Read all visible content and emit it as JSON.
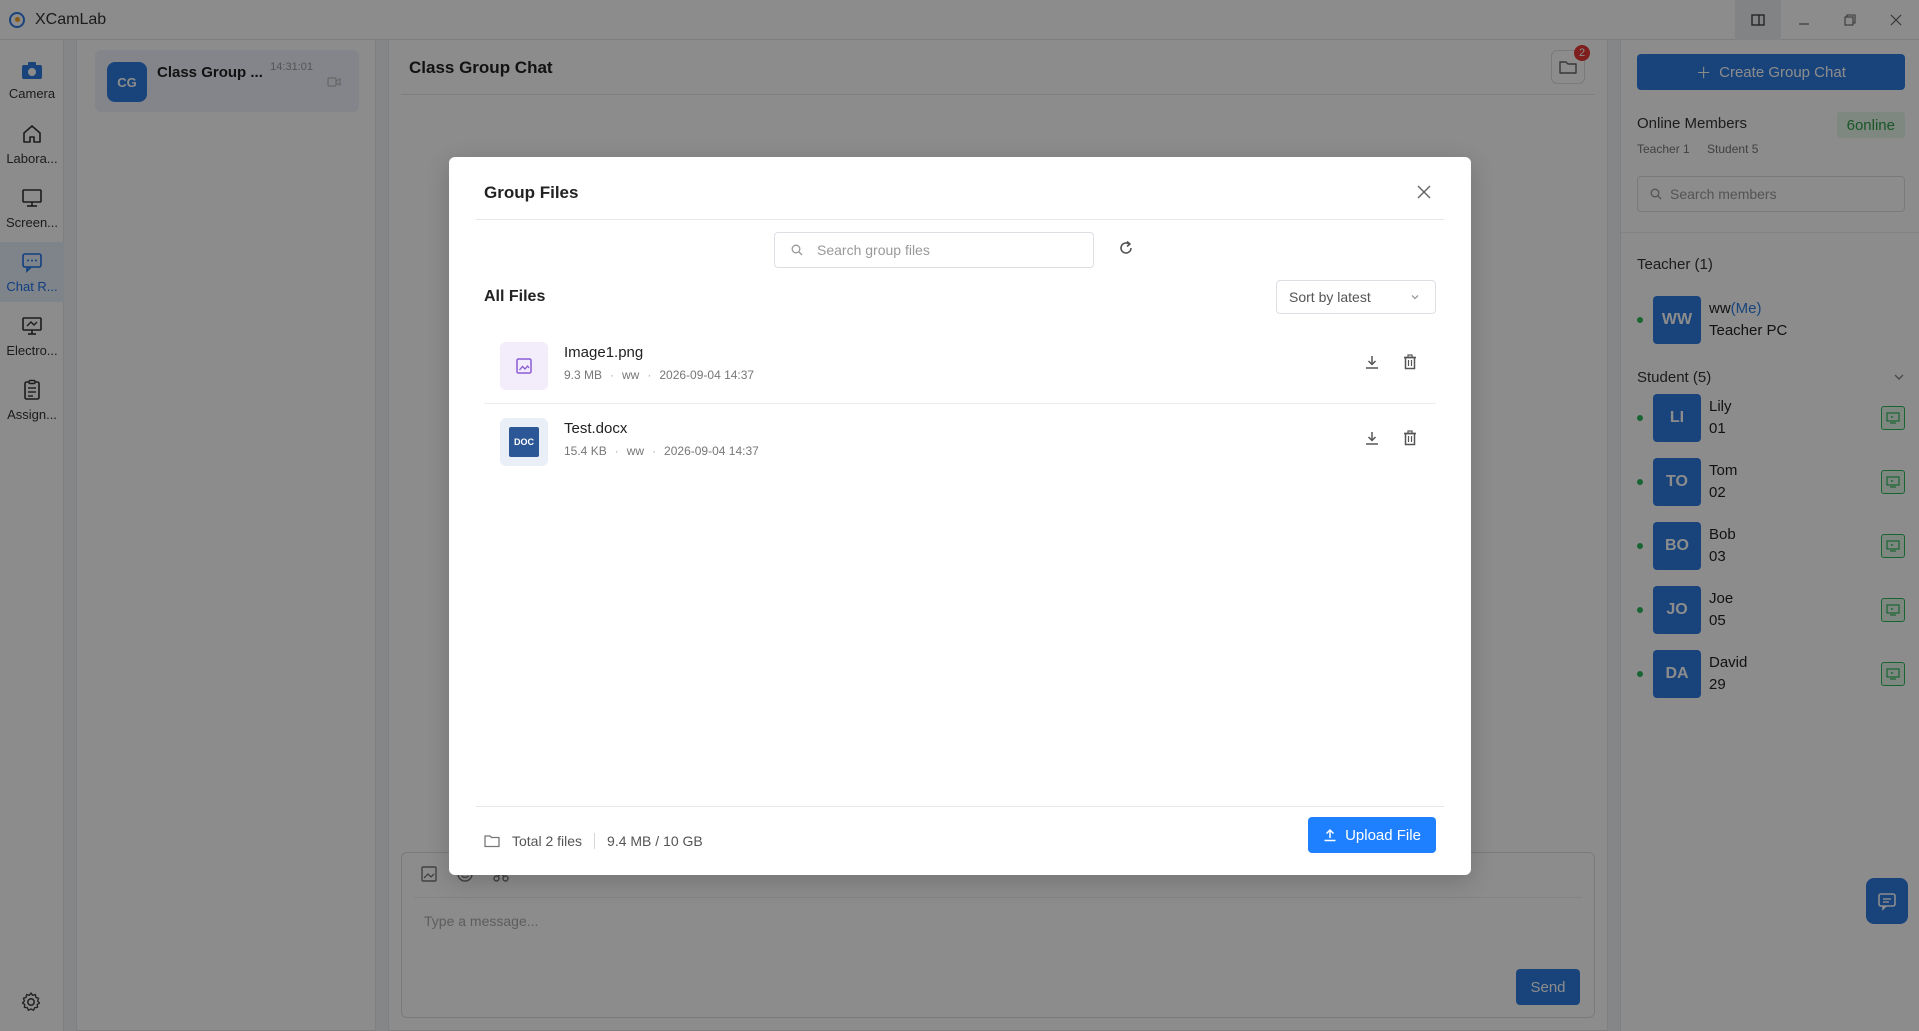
{
  "app": {
    "title": "XCamLab"
  },
  "nav": {
    "items": [
      {
        "label": "Camera"
      },
      {
        "label": "Labora..."
      },
      {
        "label": "Screen..."
      },
      {
        "label": "Chat R..."
      },
      {
        "label": "Electro..."
      },
      {
        "label": "Assign..."
      }
    ],
    "active_index": 3
  },
  "chatlist": {
    "items": [
      {
        "avatar": "CG",
        "name": "Class Group ...",
        "time": "14:31:01"
      }
    ]
  },
  "chat": {
    "title": "Class Group Chat",
    "files_badge": "2",
    "composer_placeholder": "Type a message...",
    "send_label": "Send"
  },
  "right": {
    "create_label": "Create Group Chat",
    "online_title": "Online Members",
    "online_badge": "6online",
    "online_teacher": "Teacher 1",
    "online_student": "Student 5",
    "search_placeholder": "Search members",
    "teacher_group": "Teacher  (1)",
    "teacher": {
      "avatar": "WW",
      "name": "ww",
      "me": "(Me)",
      "sub": "Teacher PC"
    },
    "student_group": "Student  (5)",
    "students": [
      {
        "avatar": "LI",
        "name": "Lily",
        "sub": "01"
      },
      {
        "avatar": "TO",
        "name": "Tom",
        "sub": "02"
      },
      {
        "avatar": "BO",
        "name": "Bob",
        "sub": "03"
      },
      {
        "avatar": "JO",
        "name": "Joe",
        "sub": "05"
      },
      {
        "avatar": "DA",
        "name": "David",
        "sub": "29"
      }
    ]
  },
  "modal": {
    "title": "Group Files",
    "search_placeholder": "Search group files",
    "all_files_label": "All Files",
    "sort_label": "Sort by latest",
    "files": [
      {
        "name": "Image1.png",
        "size": "9.3 MB",
        "owner": "ww",
        "date": "2026-09-04 14:37",
        "icon": "image-file-icon"
      },
      {
        "name": "Test.docx",
        "size": "15.4 KB",
        "owner": "ww",
        "date": "2026-09-04 14:37",
        "icon": "doc-file-icon",
        "icon_text": "DOC"
      }
    ],
    "total_label": "Total 2 files",
    "storage_label": "9.4 MB / 10 GB",
    "upload_label": "Upload File"
  },
  "colors": {
    "accent": "#2f7de1",
    "online": "#2eb85c",
    "badge": "#e53935"
  }
}
